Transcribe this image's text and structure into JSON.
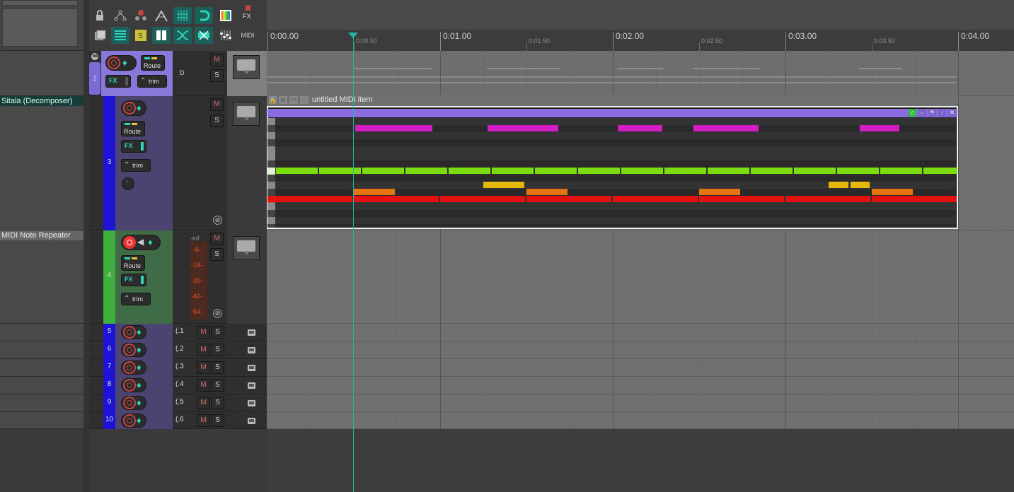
{
  "toolbar": {
    "row1": [
      "lock-icon",
      "ripple-icon",
      "grouping-icon",
      "snap-icon",
      "grid-icon",
      "magnet-icon",
      "color-icon",
      "fx-cross-icon"
    ],
    "fx_label": "FX",
    "midi_label": "MIDI"
  },
  "track_names": {
    "decomposer": "Sitala (Decomposer)",
    "repeater": "MIDI Note Repeater"
  },
  "tracks": [
    {
      "num": "2",
      "route": "Route",
      "fx": "FX",
      "trim": "trim",
      "mute": "M",
      "solo": "S",
      "input": "D"
    },
    {
      "num": "3",
      "route": "Route",
      "fx": "FX",
      "trim": "trim",
      "mute": "M",
      "solo": "S"
    },
    {
      "num": "4",
      "route": "Route",
      "fx": "FX",
      "trim": "trim",
      "mute": "M",
      "solo": "S",
      "meter_labels": [
        "-inf",
        "-6-",
        "-18-",
        "-30-",
        "-42-",
        "-54-"
      ]
    },
    {
      "num": "5",
      "input": "(.1",
      "mute": "M",
      "solo": "S"
    },
    {
      "num": "6",
      "input": "(.2",
      "mute": "M",
      "solo": "S"
    },
    {
      "num": "7",
      "input": "(.3",
      "mute": "M",
      "solo": "S"
    },
    {
      "num": "8",
      "input": "(.4",
      "mute": "M",
      "solo": "S"
    },
    {
      "num": "9",
      "input": "(.5",
      "mute": "M",
      "solo": "S"
    },
    {
      "num": "10",
      "input": "(.6",
      "mute": "M",
      "solo": "S"
    }
  ],
  "ruler": {
    "major": [
      "0:00.00",
      "0:01.00",
      "0:02.00",
      "0:03.00",
      "0:04.00"
    ],
    "minor": [
      "0:00.50",
      "0:01.50",
      "0:02.50",
      "0:03.50"
    ]
  },
  "midi_item": {
    "title": "untitled MIDI item",
    "colors": {
      "item_bar": "#8a6ce0",
      "pink": "#d21cc4",
      "lime": "#7ddc0e",
      "yellow": "#e6b80c",
      "orange": "#e47510",
      "red": "#e4120f"
    }
  },
  "colors": {
    "track2": "#7a6bd6",
    "track3": "#1d12d6",
    "track4": "#3fae3f",
    "teal": "#23b3a5"
  }
}
